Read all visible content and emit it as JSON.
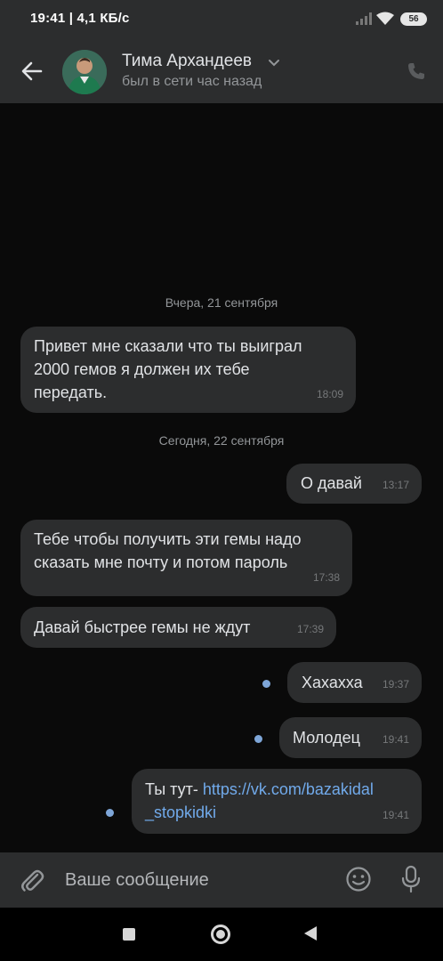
{
  "status_bar": {
    "time_speed": "19:41 | 4,1 КБ/с",
    "battery": "56"
  },
  "header": {
    "name": "Тима Архандеев",
    "last_seen": "был в сети час назад",
    "icons": [
      "back-arrow-icon",
      "chevron-down-icon",
      "phone-icon"
    ]
  },
  "chat": {
    "date_yesterday": "Вчера, 21 сентября",
    "date_today": "Сегодня, 22 сентября",
    "messages": [
      {
        "direction": "in",
        "lines": [
          "Привет мне сказали что ты выиграл",
          "2000 гемов я должен их тебе",
          "передать."
        ],
        "time": "18:09"
      },
      {
        "direction": "out",
        "text": "О давай",
        "time": "13:17"
      },
      {
        "direction": "in",
        "lines": [
          "Тебе чтобы получить эти гемы надо",
          "сказать мне почту и потом пароль"
        ],
        "time": "17:38"
      },
      {
        "direction": "in",
        "text": "Давай быстрее гемы не ждут",
        "time": "17:39"
      },
      {
        "direction": "out",
        "text": "Хахахха",
        "time": "19:37",
        "unread_dot": true
      },
      {
        "direction": "out",
        "text": "Молодец",
        "time": "19:41",
        "unread_dot": true
      },
      {
        "direction": "out",
        "prefix": "Ты тут-",
        "link_line1": "https://vk.com/bazakidal",
        "link_line2": "_stopkidki",
        "time": "19:41",
        "unread_dot": true
      }
    ]
  },
  "composer": {
    "placeholder": "Ваше сообщение",
    "icons": [
      "paperclip-icon",
      "smile-icon",
      "microphone-icon"
    ]
  },
  "navbar": {
    "icons": [
      "recent-apps-icon",
      "home-icon",
      "back-icon"
    ]
  },
  "colors": {
    "background": "#0a0a0a",
    "panel": "#2c2d2e",
    "bubble": "#2c2d2e",
    "text": "#e1e3e6",
    "muted": "#939699",
    "link": "#71aaeb",
    "unread_dot": "#7ea6d8"
  }
}
